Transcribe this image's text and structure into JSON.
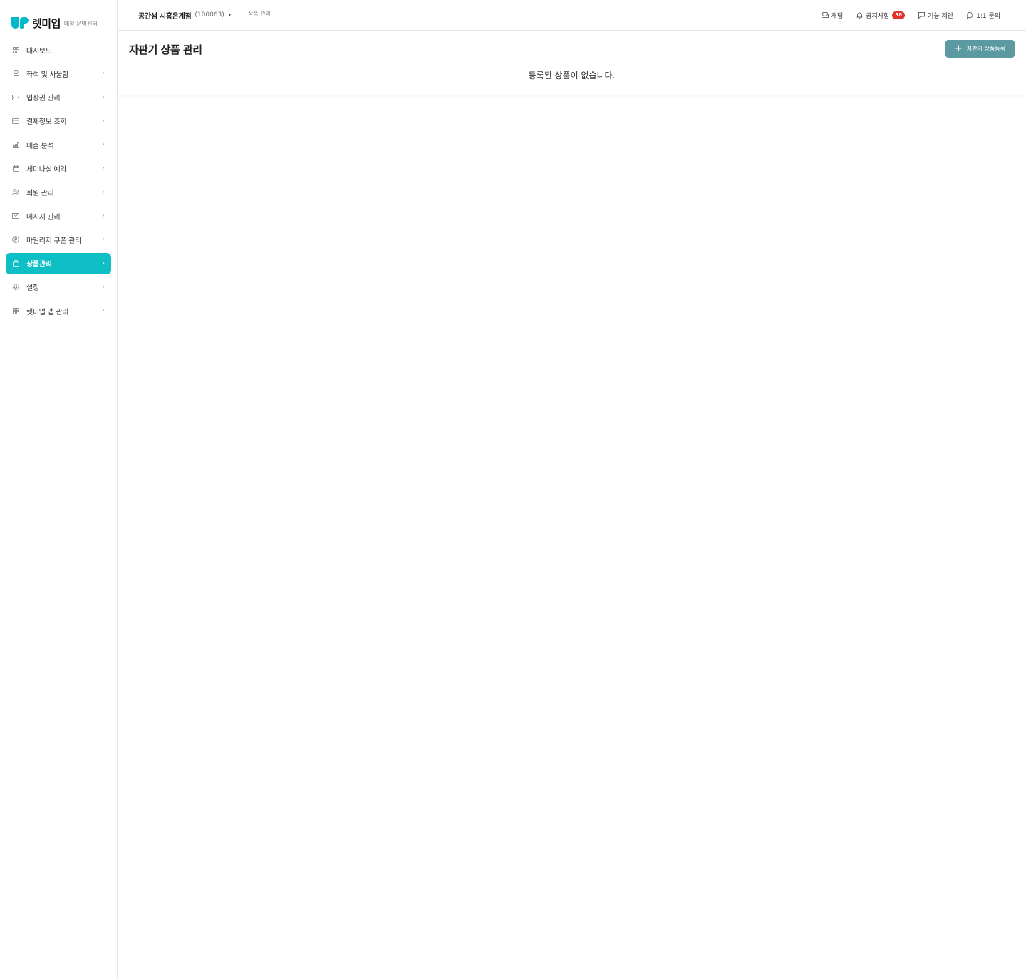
{
  "brand": {
    "name": "렛미업",
    "sub": "매장 운영센터",
    "accent": "#00b9c9"
  },
  "sidebar": {
    "active_color": "#0fbfc6",
    "items": [
      {
        "label": "대시보드",
        "icon": "grid-icon",
        "chevron": ""
      },
      {
        "label": "좌석 및 사물함",
        "icon": "seat-icon",
        "chevron": "›"
      },
      {
        "label": "입장권 관리",
        "icon": "ticket-icon",
        "chevron": "›"
      },
      {
        "label": "결제정보 조회",
        "icon": "card-icon",
        "chevron": "›"
      },
      {
        "label": "매출 분석",
        "icon": "chart-icon",
        "chevron": "›"
      },
      {
        "label": "세미나실 예약",
        "icon": "calendar-icon",
        "chevron": "›"
      },
      {
        "label": "회원 관리",
        "icon": "users-icon",
        "chevron": "›"
      },
      {
        "label": "메시지 관리",
        "icon": "mail-icon",
        "chevron": "›"
      },
      {
        "label": "마일리지 쿠폰 관리",
        "icon": "mileage-icon",
        "chevron": "›"
      },
      {
        "label": "상품관리",
        "icon": "bag-icon",
        "chevron": "›",
        "active": true
      },
      {
        "label": "설정",
        "icon": "gear-icon",
        "chevron": "›"
      },
      {
        "label": "렛미업 앱 관리",
        "icon": "apps-icon",
        "chevron": "›"
      }
    ]
  },
  "header": {
    "store_name": "공간샘 시흥은계점",
    "store_code": "(100063)",
    "store_caret": "▾",
    "breadcrumb": "상품 관리",
    "links": {
      "chat": "채팅",
      "notice": "공지사항",
      "notice_count": "38",
      "suggest": "기능 제안",
      "inquiry": "1:1 문의"
    }
  },
  "main": {
    "title": "자판기 상품 관리",
    "add_button": "자판기 상품등록",
    "add_button_icon": "+",
    "add_button_color": "#5b9aa0",
    "empty_message": "등록된 상품이 없습니다."
  }
}
